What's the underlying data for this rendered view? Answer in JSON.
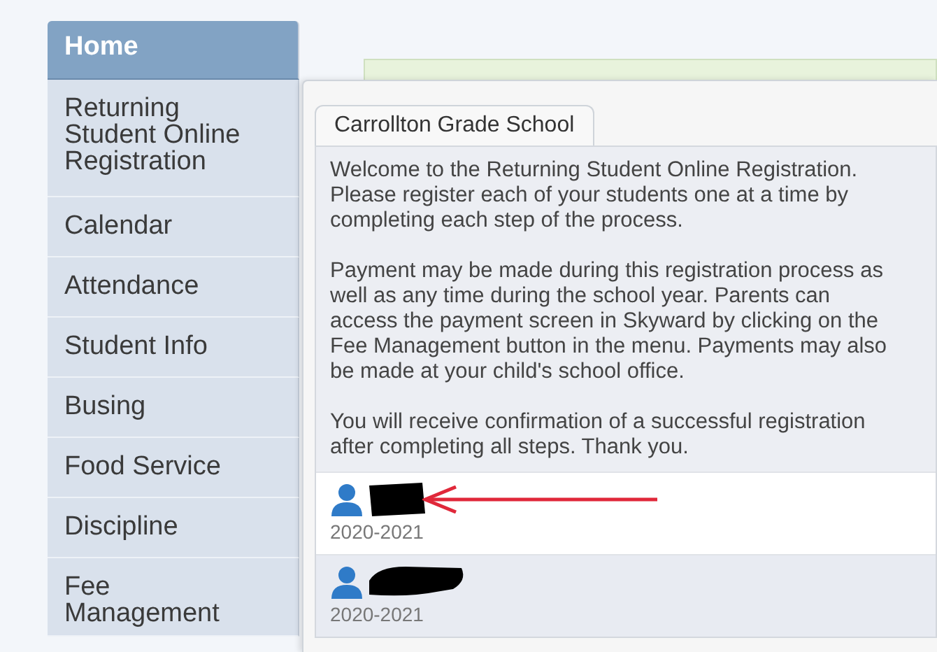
{
  "sidebar": {
    "items": [
      {
        "label": "Home",
        "selected": true
      },
      {
        "label": "Returning Student Online Registration",
        "selected": false
      },
      {
        "label": "Calendar",
        "selected": false
      },
      {
        "label": "Attendance",
        "selected": false
      },
      {
        "label": "Student Info",
        "selected": false
      },
      {
        "label": "Busing",
        "selected": false
      },
      {
        "label": "Food Service",
        "selected": false
      },
      {
        "label": "Discipline",
        "selected": false
      },
      {
        "label": "Fee Management",
        "selected": false
      }
    ]
  },
  "panel": {
    "tab": "Carrollton Grade School",
    "paragraphs": [
      "Welcome to the Returning Student Online Registration. Please register each of your students one at a time by completing each step of the process.",
      "Payment may be made during this registration process as well as any time during the school year. Parents can access the payment screen in Skyward by clicking on the Fee Management button in the menu. Payments may also be made at your child's school office.",
      "You will receive confirmation of a successful registration after completing all steps. Thank you."
    ],
    "students": [
      {
        "year": "2020-2021",
        "selected": true
      },
      {
        "year": "2020-2021",
        "selected": false
      }
    ]
  }
}
